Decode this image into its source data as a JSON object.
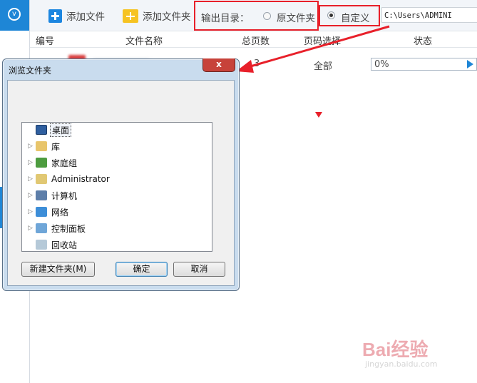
{
  "toolbar": {
    "add_file": "添加文件",
    "add_folder": "添加文件夹",
    "output_label": "输出目录：",
    "option_original": "原文件夹",
    "option_custom": "自定义",
    "path_value": "C:\\Users\\ADMINI"
  },
  "table": {
    "headers": [
      "编号",
      "文件名称",
      "总页数",
      "页码选择",
      "状态"
    ],
    "row": {
      "pages": "3",
      "range": "全部",
      "progress": "0%"
    }
  },
  "dialog": {
    "title": "浏览文件夹",
    "close": "x",
    "tree": [
      {
        "label": "桌面",
        "icon": "desktop-icon",
        "expandable": false,
        "selected": true
      },
      {
        "label": "库",
        "icon": "library-icon",
        "expandable": true
      },
      {
        "label": "家庭组",
        "icon": "homegroup-icon",
        "expandable": true
      },
      {
        "label": "Administrator",
        "icon": "user-folder-icon",
        "expandable": true
      },
      {
        "label": "计算机",
        "icon": "computer-icon",
        "expandable": true
      },
      {
        "label": "网络",
        "icon": "network-icon",
        "expandable": true
      },
      {
        "label": "控制面板",
        "icon": "control-panel-icon",
        "expandable": true
      },
      {
        "label": "回收站",
        "icon": "recycle-bin-icon",
        "expandable": false
      }
    ],
    "btn_new": "新建文件夹(M)",
    "btn_ok": "确定",
    "btn_cancel": "取消"
  },
  "watermark": {
    "logo": "Bai经验",
    "sub": "jingyan.baidu.com"
  },
  "colors": {
    "accent": "#1e86d6",
    "highlight": "#e8202a"
  }
}
